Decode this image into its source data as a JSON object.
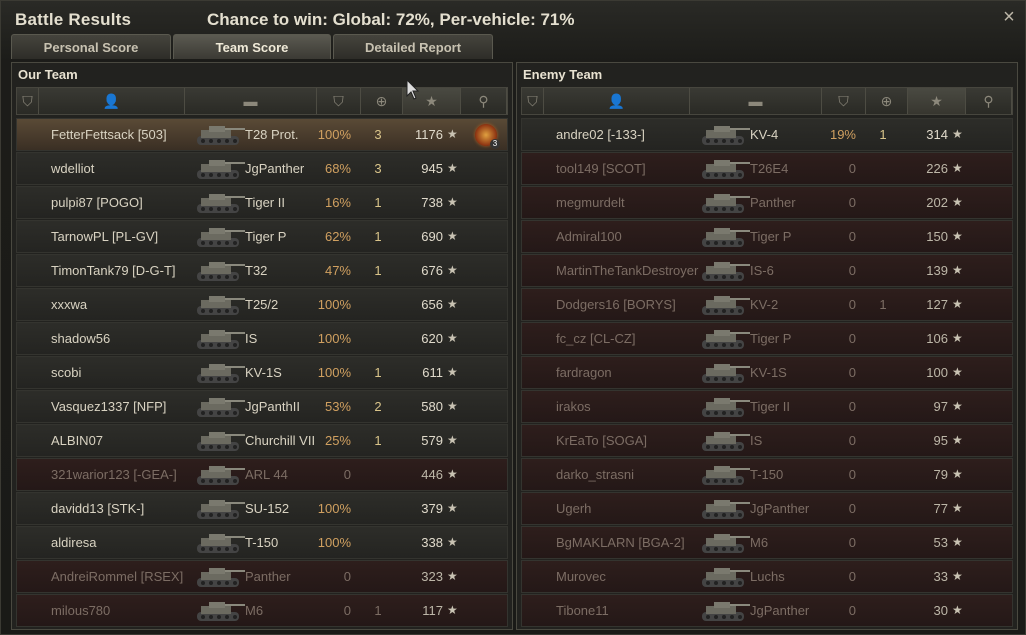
{
  "window": {
    "title": "Battle Results",
    "chance": "Chance to win: Global: 72%, Per-vehicle: 71%",
    "close_icon": "×"
  },
  "tabs": [
    {
      "label": "Personal Score",
      "active": false
    },
    {
      "label": "Team Score",
      "active": true
    },
    {
      "label": "Detailed Report",
      "active": false
    }
  ],
  "columns": [
    "platoon-icon",
    "player-icon",
    "tank-icon",
    "damage-icon",
    "kills-icon",
    "experience-star-icon",
    "medal-icon"
  ],
  "star_glyph": "★",
  "our_team": {
    "title": "Our Team",
    "rows": [
      {
        "name": "FetterFettsack [503]",
        "vehicle": "T28 Prot.",
        "damage": "100%",
        "kills": "3",
        "exp": "1176",
        "status": "me",
        "medal": "3"
      },
      {
        "name": "wdelliot",
        "vehicle": "JgPanther",
        "damage": "68%",
        "kills": "3",
        "exp": "945",
        "status": "alive"
      },
      {
        "name": "pulpi87 [POGO]",
        "vehicle": "Tiger II",
        "damage": "16%",
        "kills": "1",
        "exp": "738",
        "status": "alive"
      },
      {
        "name": "TarnowPL [PL-GV]",
        "vehicle": "Tiger P",
        "damage": "62%",
        "kills": "1",
        "exp": "690",
        "status": "alive"
      },
      {
        "name": "TimonTank79 [D-G-T]",
        "vehicle": "T32",
        "damage": "47%",
        "kills": "1",
        "exp": "676",
        "status": "alive"
      },
      {
        "name": "xxxwa",
        "vehicle": "T25/2",
        "damage": "100%",
        "kills": "",
        "exp": "656",
        "status": "alive"
      },
      {
        "name": "shadow56",
        "vehicle": "IS",
        "damage": "100%",
        "kills": "",
        "exp": "620",
        "status": "alive"
      },
      {
        "name": "scobi",
        "vehicle": "KV-1S",
        "damage": "100%",
        "kills": "1",
        "exp": "611",
        "status": "alive"
      },
      {
        "name": "Vasquez1337 [NFP]",
        "vehicle": "JgPanthII",
        "damage": "53%",
        "kills": "2",
        "exp": "580",
        "status": "alive"
      },
      {
        "name": "ALBIN07",
        "vehicle": "Churchill VII",
        "damage": "25%",
        "kills": "1",
        "exp": "579",
        "status": "alive"
      },
      {
        "name": "321warior123 [-GEA-]",
        "vehicle": "ARL 44",
        "damage": "0",
        "kills": "",
        "exp": "446",
        "status": "dead"
      },
      {
        "name": "davidd13 [STK-]",
        "vehicle": "SU-152",
        "damage": "100%",
        "kills": "",
        "exp": "379",
        "status": "alive"
      },
      {
        "name": "aldiresa",
        "vehicle": "T-150",
        "damage": "100%",
        "kills": "",
        "exp": "338",
        "status": "alive"
      },
      {
        "name": "AndreiRommel [RSEX]",
        "vehicle": "Panther",
        "damage": "0",
        "kills": "",
        "exp": "323",
        "status": "dead"
      },
      {
        "name": "milous780",
        "vehicle": "M6",
        "damage": "0",
        "kills": "1",
        "exp": "117",
        "status": "dead"
      }
    ]
  },
  "enemy_team": {
    "title": "Enemy Team",
    "rows": [
      {
        "name": "andre02 [-133-]",
        "vehicle": "KV-4",
        "damage": "19%",
        "kills": "1",
        "exp": "314",
        "status": "alive"
      },
      {
        "name": "tool149 [SCOT]",
        "vehicle": "T26E4",
        "damage": "0",
        "kills": "",
        "exp": "226",
        "status": "dead"
      },
      {
        "name": "megmurdelt",
        "vehicle": "Panther",
        "damage": "0",
        "kills": "",
        "exp": "202",
        "status": "dead"
      },
      {
        "name": "Admiral100",
        "vehicle": "Tiger P",
        "damage": "0",
        "kills": "",
        "exp": "150",
        "status": "dead"
      },
      {
        "name": "MartinTheTankDestroyer",
        "vehicle": "IS-6",
        "damage": "0",
        "kills": "",
        "exp": "139",
        "status": "dead"
      },
      {
        "name": "Dodgers16 [BORYS]",
        "vehicle": "KV-2",
        "damage": "0",
        "kills": "1",
        "exp": "127",
        "status": "dead"
      },
      {
        "name": "fc_cz [CL-CZ]",
        "vehicle": "Tiger P",
        "damage": "0",
        "kills": "",
        "exp": "106",
        "status": "dead"
      },
      {
        "name": "fardragon",
        "vehicle": "KV-1S",
        "damage": "0",
        "kills": "",
        "exp": "100",
        "status": "dead"
      },
      {
        "name": "irakos",
        "vehicle": "Tiger II",
        "damage": "0",
        "kills": "",
        "exp": "97",
        "status": "dead"
      },
      {
        "name": "KrEaTo [SOGA]",
        "vehicle": "IS",
        "damage": "0",
        "kills": "",
        "exp": "95",
        "status": "dead"
      },
      {
        "name": "darko_strasni",
        "vehicle": "T-150",
        "damage": "0",
        "kills": "",
        "exp": "79",
        "status": "dead"
      },
      {
        "name": "Ugerh",
        "vehicle": "JgPanther",
        "damage": "0",
        "kills": "",
        "exp": "77",
        "status": "dead"
      },
      {
        "name": "BgMAKLARN [BGA-2]",
        "vehicle": "M6",
        "damage": "0",
        "kills": "",
        "exp": "53",
        "status": "dead"
      },
      {
        "name": "Murovec",
        "vehicle": "Luchs",
        "damage": "0",
        "kills": "",
        "exp": "33",
        "status": "dead"
      },
      {
        "name": "Tibone11",
        "vehicle": "JgPanther",
        "damage": "0",
        "kills": "",
        "exp": "30",
        "status": "dead"
      }
    ]
  },
  "colors": {
    "accent": "#d0a060",
    "dead_row": "#2e1e1c",
    "me_row": "#5a4a36"
  }
}
